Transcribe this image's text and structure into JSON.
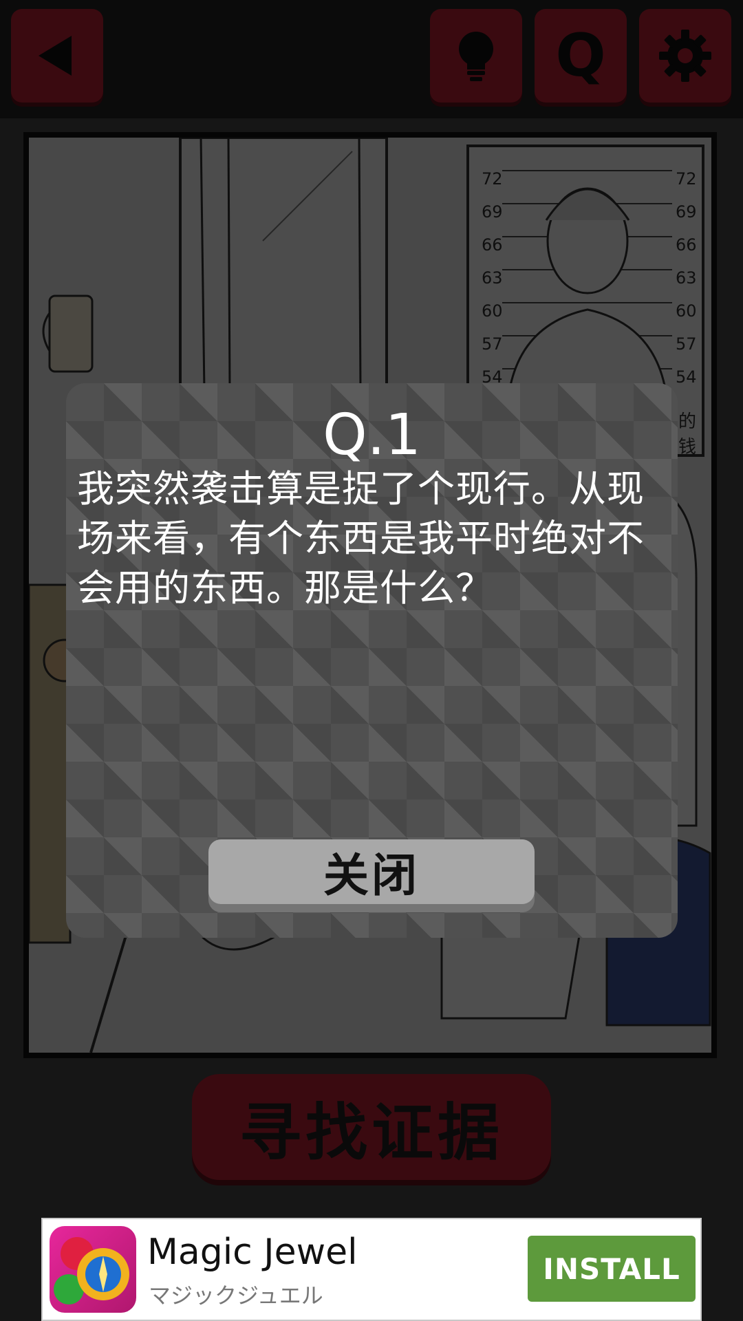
{
  "topbar": {
    "back_icon": "back-triangle-icon",
    "hint_icon": "lightbulb-icon",
    "question_label": "Q",
    "settings_icon": "gear-icon"
  },
  "scene": {
    "chart_ruler_labels": [
      "72",
      "69",
      "66",
      "63",
      "60",
      "57",
      "54"
    ],
    "sign_fragment": "的钱"
  },
  "modal": {
    "title": "Q.1",
    "body": "我突然袭击算是捉了个现行。从现场来看，有个东西是我平时绝对不会用的东西。那是什么？",
    "close_label": "关闭"
  },
  "main": {
    "find_evidence_label": "寻找证据"
  },
  "ad": {
    "title": "Magic Jewel",
    "subtitle": "マジックジュエル",
    "install_label": "INSTALL"
  },
  "colors": {
    "button_red": "#3a0a10",
    "install_green": "#5d9a3c",
    "modal_gray": "#505050"
  }
}
